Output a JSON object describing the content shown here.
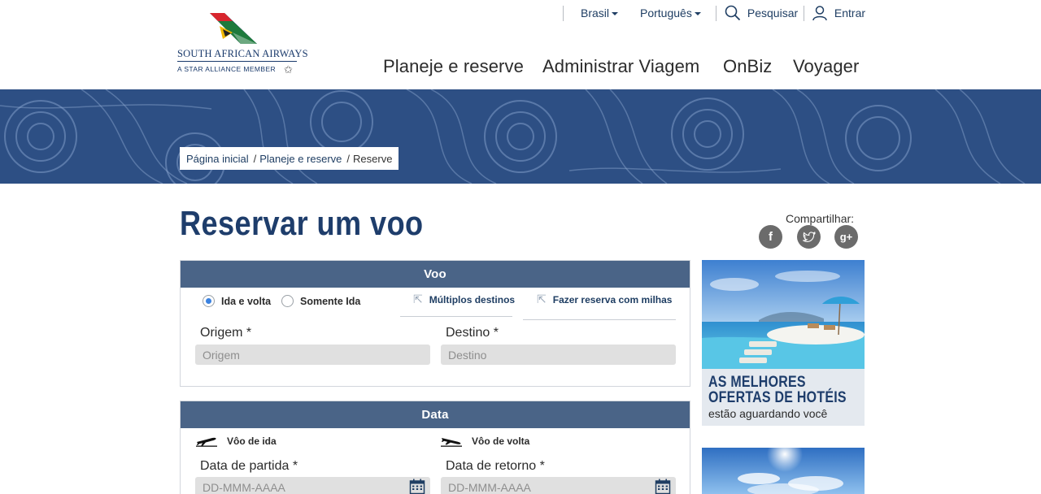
{
  "brand": {
    "name": "South African Airways",
    "line1": "SOUTH AFRICAN AIRWAYS",
    "line2": "A STAR ALLIANCE MEMBER"
  },
  "utility": {
    "country": "Brasil",
    "language": "Português",
    "search": "Pesquisar",
    "login": "Entrar"
  },
  "nav": [
    "Planeje e reserve",
    "Administrar Viagem",
    "OnBiz",
    "Voyager"
  ],
  "breadcrumb": {
    "home": "Página inicial",
    "section": "Planeje e reserve",
    "current": "Reserve",
    "separator": "/"
  },
  "page": {
    "title": "Reservar um voo",
    "share_label": "Compartilhar:"
  },
  "share": [
    "f",
    "t",
    "g+"
  ],
  "flight_panel": {
    "title": "Voo",
    "round_trip": "Ida e volta",
    "one_way": "Somente Ida",
    "multi_city": "Múltiplos destinos",
    "miles": "Fazer reserva com milhas",
    "selected": "Ida e volta",
    "origin_label": "Origem *",
    "origin_placeholder": "Origem",
    "destination_label": "Destino *",
    "destination_placeholder": "Destino"
  },
  "date_panel": {
    "title": "Data",
    "outbound": "Vôo de ida",
    "return": "Vôo de volta",
    "departure_label": "Data de partida *",
    "return_label": "Data de retorno *",
    "date_placeholder": "DD-MMM-AAAA"
  },
  "promo": {
    "title_line1": "AS MELHORES",
    "title_line2": "OFERTAS DE HOTÉIS",
    "subtitle": "estão aguardando você"
  },
  "icons": {
    "search": "search-icon",
    "user": "user-icon",
    "calendar": "calendar-icon",
    "plane_departure": "plane-departure-icon",
    "plane_arrival": "plane-arrival-icon",
    "external": "external-link-icon"
  },
  "colors": {
    "brand_navy": "#1e3d6b",
    "panel_header": "#4a6487",
    "banner": "#2d4f84",
    "radio_active": "#3a82e0"
  }
}
